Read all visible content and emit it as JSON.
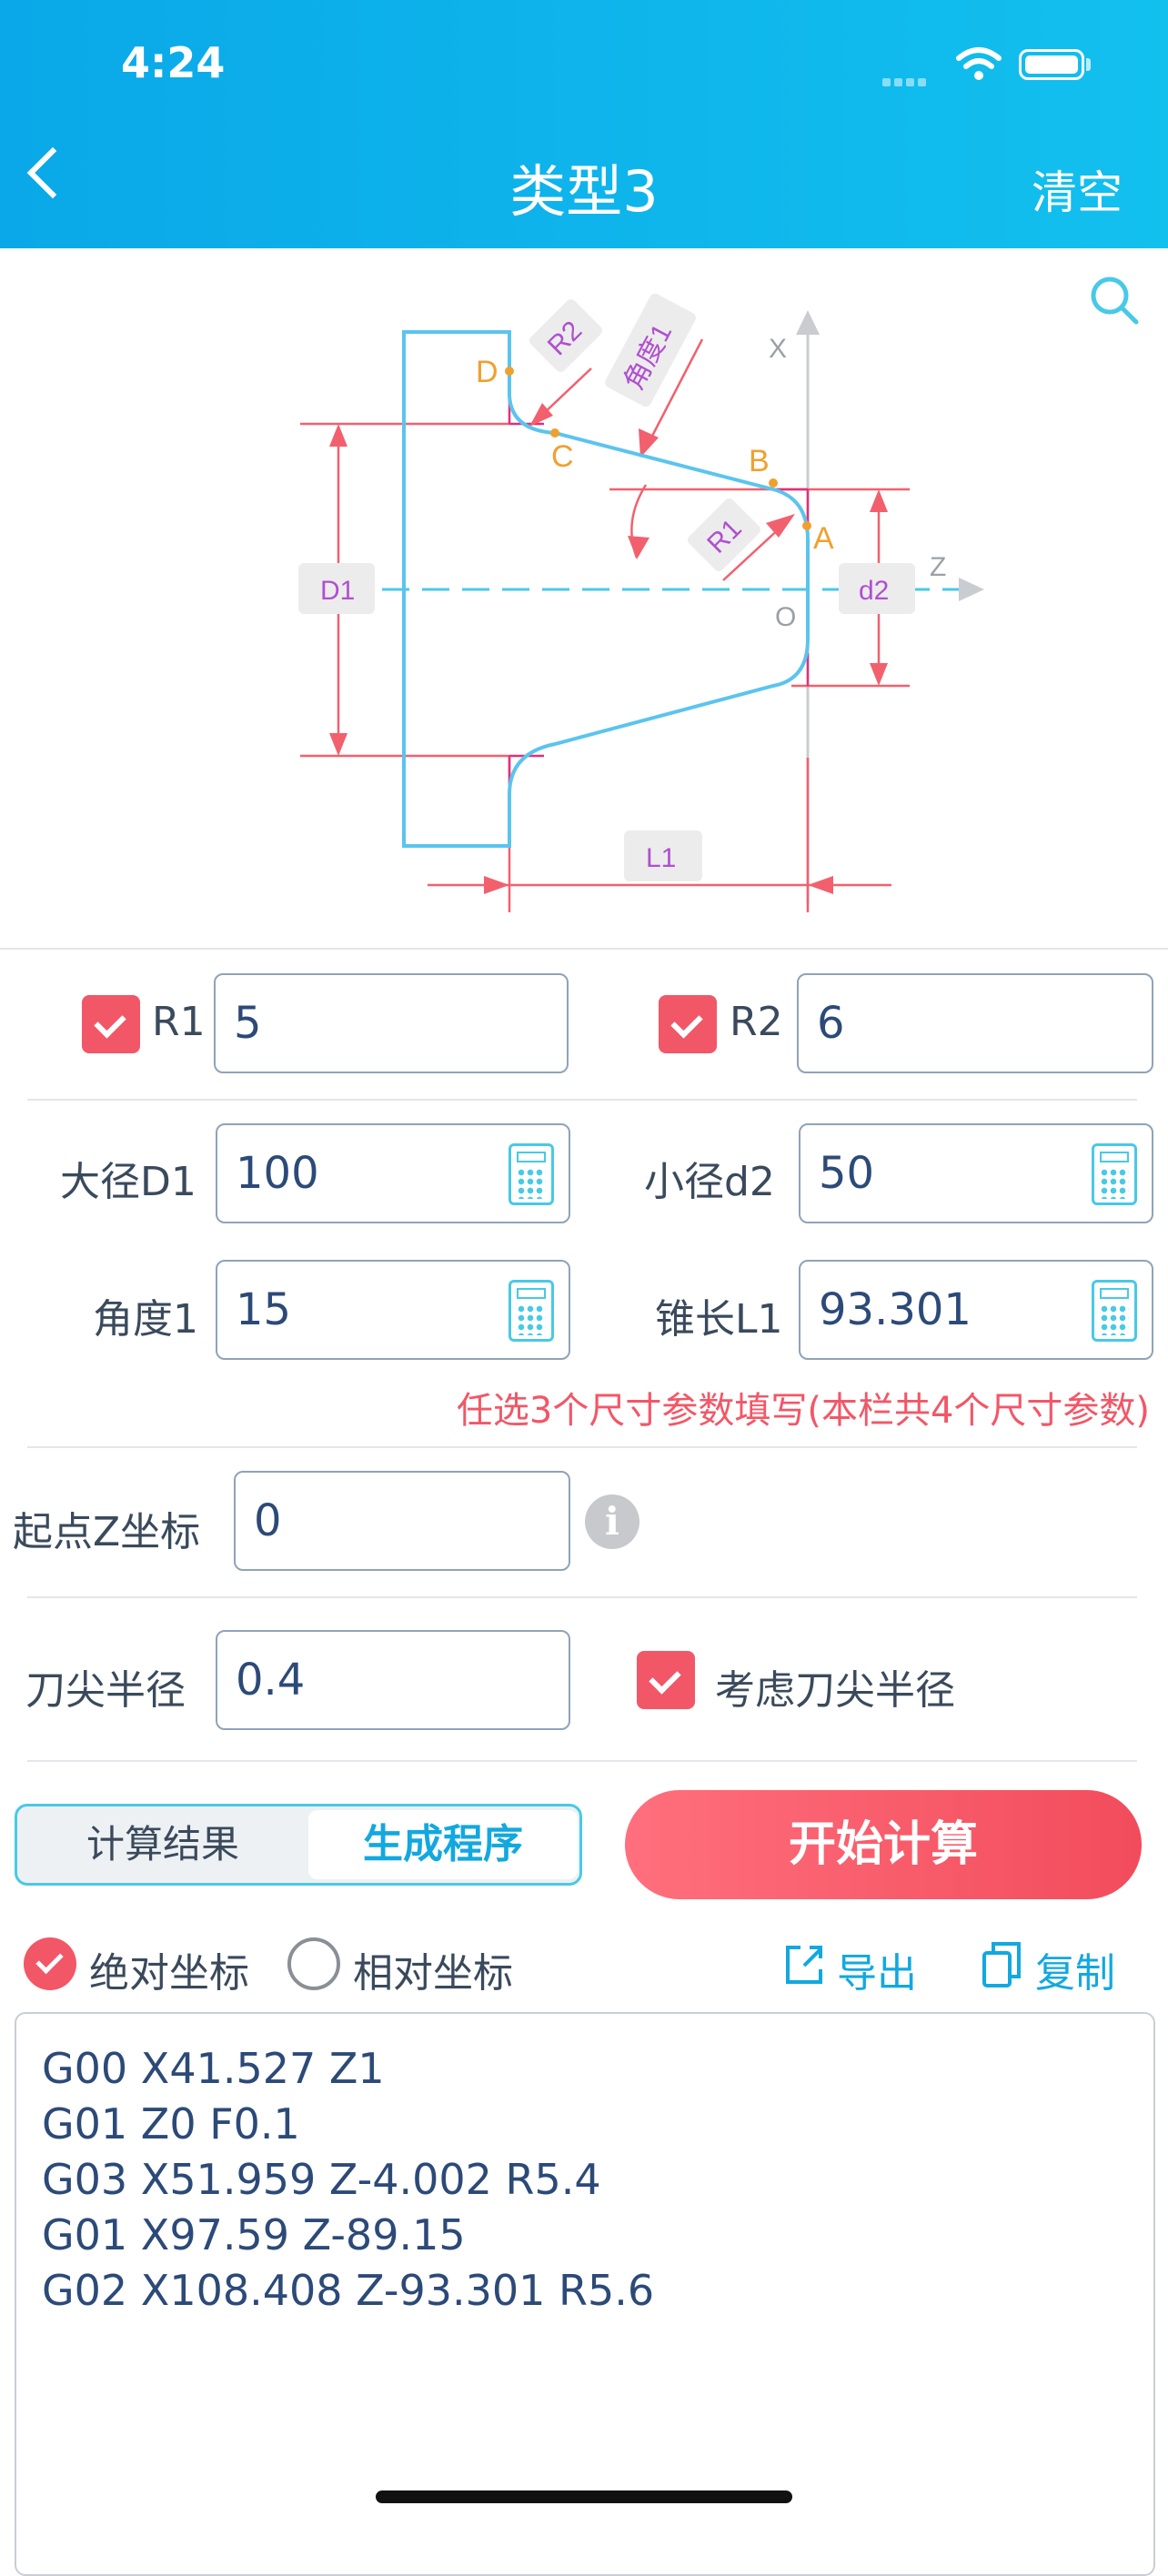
{
  "status": {
    "time": "4:24"
  },
  "nav": {
    "title": "类型3",
    "clear": "清空"
  },
  "diagram": {
    "labels": {
      "R1": "R1",
      "R2": "R2",
      "angle1": "角度1",
      "D1": "D1",
      "d2": "d2",
      "L1": "L1",
      "X": "X",
      "Z": "Z",
      "O": "O",
      "A": "A",
      "B": "B",
      "C": "C",
      "D": "D"
    }
  },
  "params": {
    "r1": {
      "label": "R1",
      "value": "5",
      "checked": true
    },
    "r2": {
      "label": "R2",
      "value": "6",
      "checked": true
    },
    "d1": {
      "label": "大径D1",
      "value": "100"
    },
    "d2": {
      "label": "小径d2",
      "value": "50"
    },
    "angle1": {
      "label": "角度1",
      "value": "15"
    },
    "l1": {
      "label": "锥长L1",
      "value": "93.301"
    },
    "hint": "任选3个尺寸参数填写(本栏共4个尺寸参数)",
    "startz": {
      "label": "起点Z坐标",
      "value": "0"
    },
    "tool_radius": {
      "label": "刀尖半径",
      "value": "0.4"
    },
    "consider_radius": {
      "label": "考虑刀尖半径",
      "checked": true
    }
  },
  "tabs": {
    "result": "计算结果",
    "program": "生成程序",
    "active": "program"
  },
  "start_button": "开始计算",
  "coords": {
    "absolute": "绝对坐标",
    "relative": "相对坐标",
    "selected": "absolute"
  },
  "actions": {
    "export": "导出",
    "copy": "复制"
  },
  "program_lines": [
    "G00 X41.527 Z1",
    "G01 Z0 F0.1",
    "G03 X51.959 Z-4.002 R5.4",
    "G01 X97.59 Z-89.15",
    "G02 X108.408 Z-93.301 R5.6"
  ],
  "colors": {
    "accent": "#12b4ea",
    "danger": "#f25767",
    "profile": "#5bc4ee",
    "dim": "#f2606e"
  }
}
